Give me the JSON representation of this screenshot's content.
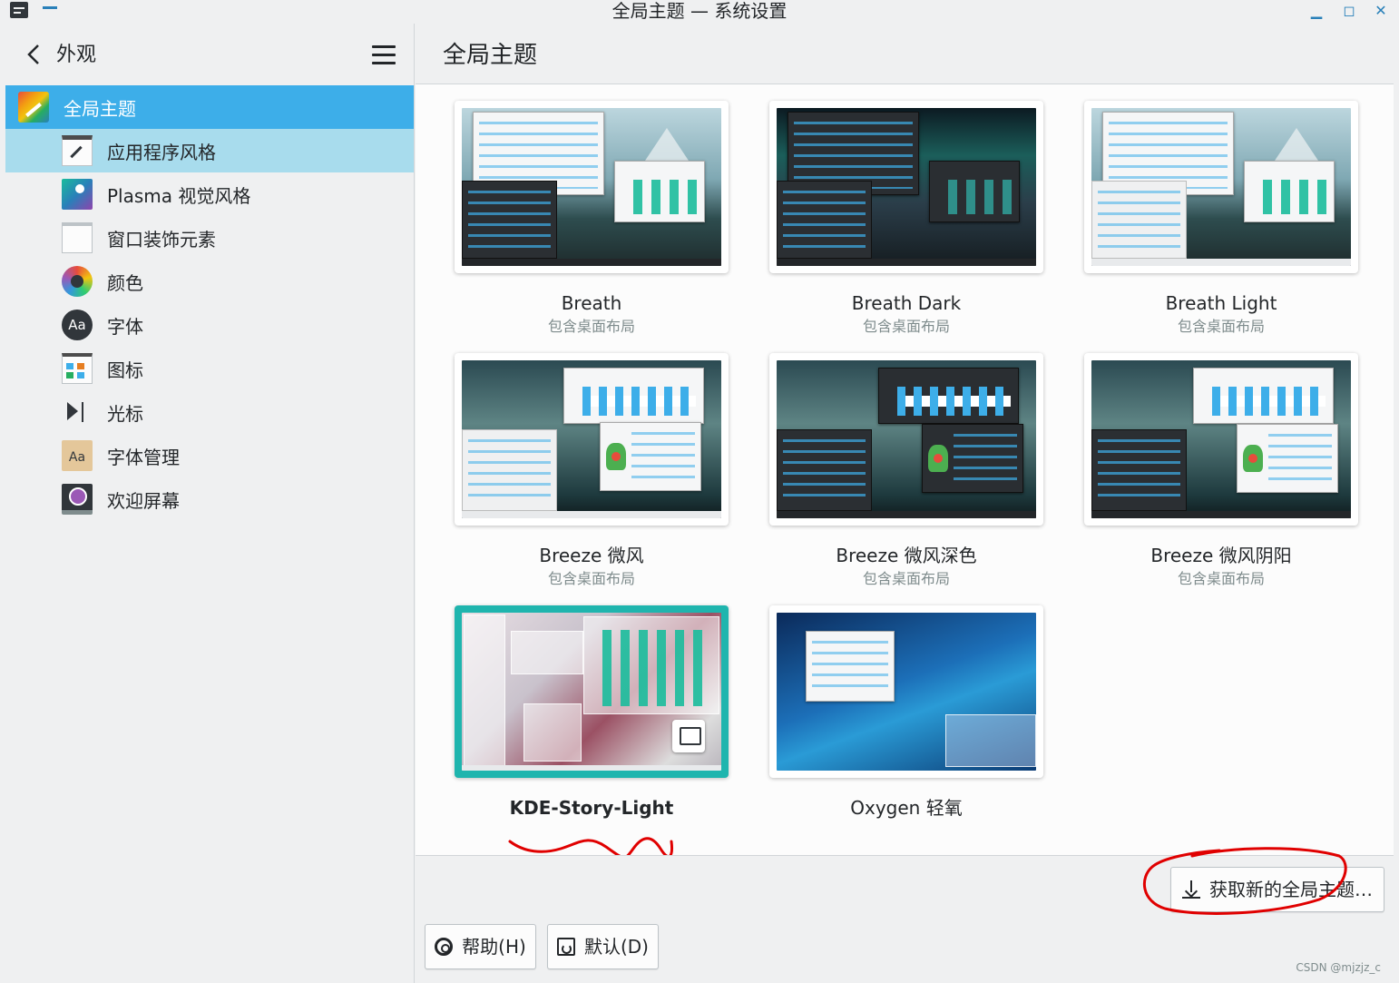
{
  "window": {
    "title": "全局主题 — 系统设置",
    "minimize_glyph": "▁",
    "maximize_glyph": "◻",
    "close_glyph": "✕"
  },
  "sidebar": {
    "title": "外观",
    "items": [
      {
        "label": "全局主题",
        "icon": "global-theme-icon",
        "state": "active"
      },
      {
        "label": "应用程序风格",
        "icon": "application-style-icon",
        "state": "hover"
      },
      {
        "label": "Plasma 视觉风格",
        "icon": "plasma-style-icon",
        "state": ""
      },
      {
        "label": "窗口装饰元素",
        "icon": "window-decoration-icon",
        "state": ""
      },
      {
        "label": "颜色",
        "icon": "colors-icon",
        "state": ""
      },
      {
        "label": "字体",
        "icon": "fonts-icon",
        "icon_text": "Aa",
        "state": ""
      },
      {
        "label": "图标",
        "icon": "icons-icon",
        "state": ""
      },
      {
        "label": "光标",
        "icon": "cursor-icon",
        "state": ""
      },
      {
        "label": "字体管理",
        "icon": "font-management-icon",
        "icon_text": "Aa",
        "state": ""
      },
      {
        "label": "欢迎屏幕",
        "icon": "splash-screen-icon",
        "state": ""
      }
    ]
  },
  "main": {
    "title": "全局主题",
    "themes": [
      {
        "name": "Breath",
        "subtitle": "包含桌面布局",
        "style": "breath",
        "selected": false
      },
      {
        "name": "Breath Dark",
        "subtitle": "包含桌面布局",
        "style": "breath-dark",
        "selected": false
      },
      {
        "name": "Breath Light",
        "subtitle": "包含桌面布局",
        "style": "breath-light",
        "selected": false
      },
      {
        "name": "Breeze 微风",
        "subtitle": "包含桌面布局",
        "style": "breeze",
        "selected": false
      },
      {
        "name": "Breeze 微风深色",
        "subtitle": "包含桌面布局",
        "style": "breeze-dark",
        "selected": false
      },
      {
        "name": "Breeze 微风阴阳",
        "subtitle": "包含桌面布局",
        "style": "breeze-twilight",
        "selected": false
      },
      {
        "name": "KDE-Story-Light",
        "subtitle": "",
        "style": "kde-story-light",
        "selected": true
      },
      {
        "name": "Oxygen 轻氧",
        "subtitle": "",
        "style": "oxygen",
        "selected": false
      }
    ],
    "get_new_button": "获取新的全局主题…",
    "help_button": "帮助(H)",
    "default_button": "默认(D)"
  },
  "watermark": "CSDN @mjzjz_c",
  "colors": {
    "accent": "#3daee9",
    "selected_border": "#1fb5ae",
    "annotation": "#e00000"
  }
}
